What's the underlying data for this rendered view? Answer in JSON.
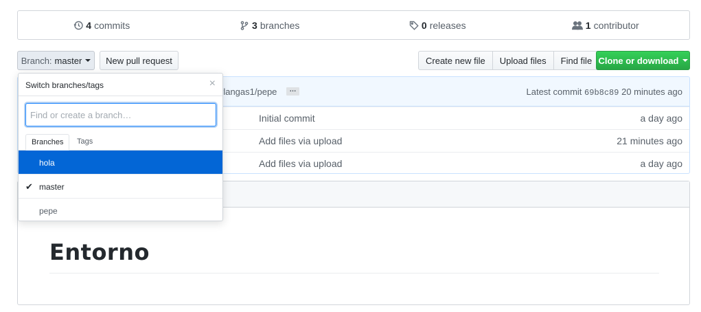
{
  "summary": {
    "commits_count": "4",
    "commits_label": "commits",
    "branches_count": "3",
    "branches_label": "branches",
    "releases_count": "0",
    "releases_label": "releases",
    "contributors_count": "1",
    "contributors_label": "contributor"
  },
  "toolbar": {
    "branch_label": "Branch:",
    "branch_value": "master",
    "new_pr": "New pull request",
    "create_file": "Create new file",
    "upload_files": "Upload files",
    "find_file": "Find file",
    "clone": "Clone or download"
  },
  "commit_bar": {
    "path": "rlangas1/pepe",
    "ellipsis": "…",
    "latest_prefix": "Latest commit",
    "sha": "69b8c89",
    "age": "20 minutes ago"
  },
  "files": [
    {
      "message": "Initial commit",
      "age": "a day ago"
    },
    {
      "message": "Add files via upload",
      "age": "21 minutes ago"
    },
    {
      "message": "Add files via upload",
      "age": "a day ago"
    }
  ],
  "readme": {
    "heading": "Entorno"
  },
  "dropdown": {
    "title": "Switch branches/tags",
    "close": "×",
    "placeholder": "Find or create a branch…",
    "tab_branches": "Branches",
    "tab_tags": "Tags",
    "branches": [
      {
        "name": "hola"
      },
      {
        "name": "master",
        "check": "✔"
      },
      {
        "name": "pepe"
      }
    ]
  },
  "colors": {
    "accent_selected": "#0366d6",
    "clone_green": "#28a745",
    "commit_bar_bg": "#f1f8ff"
  }
}
